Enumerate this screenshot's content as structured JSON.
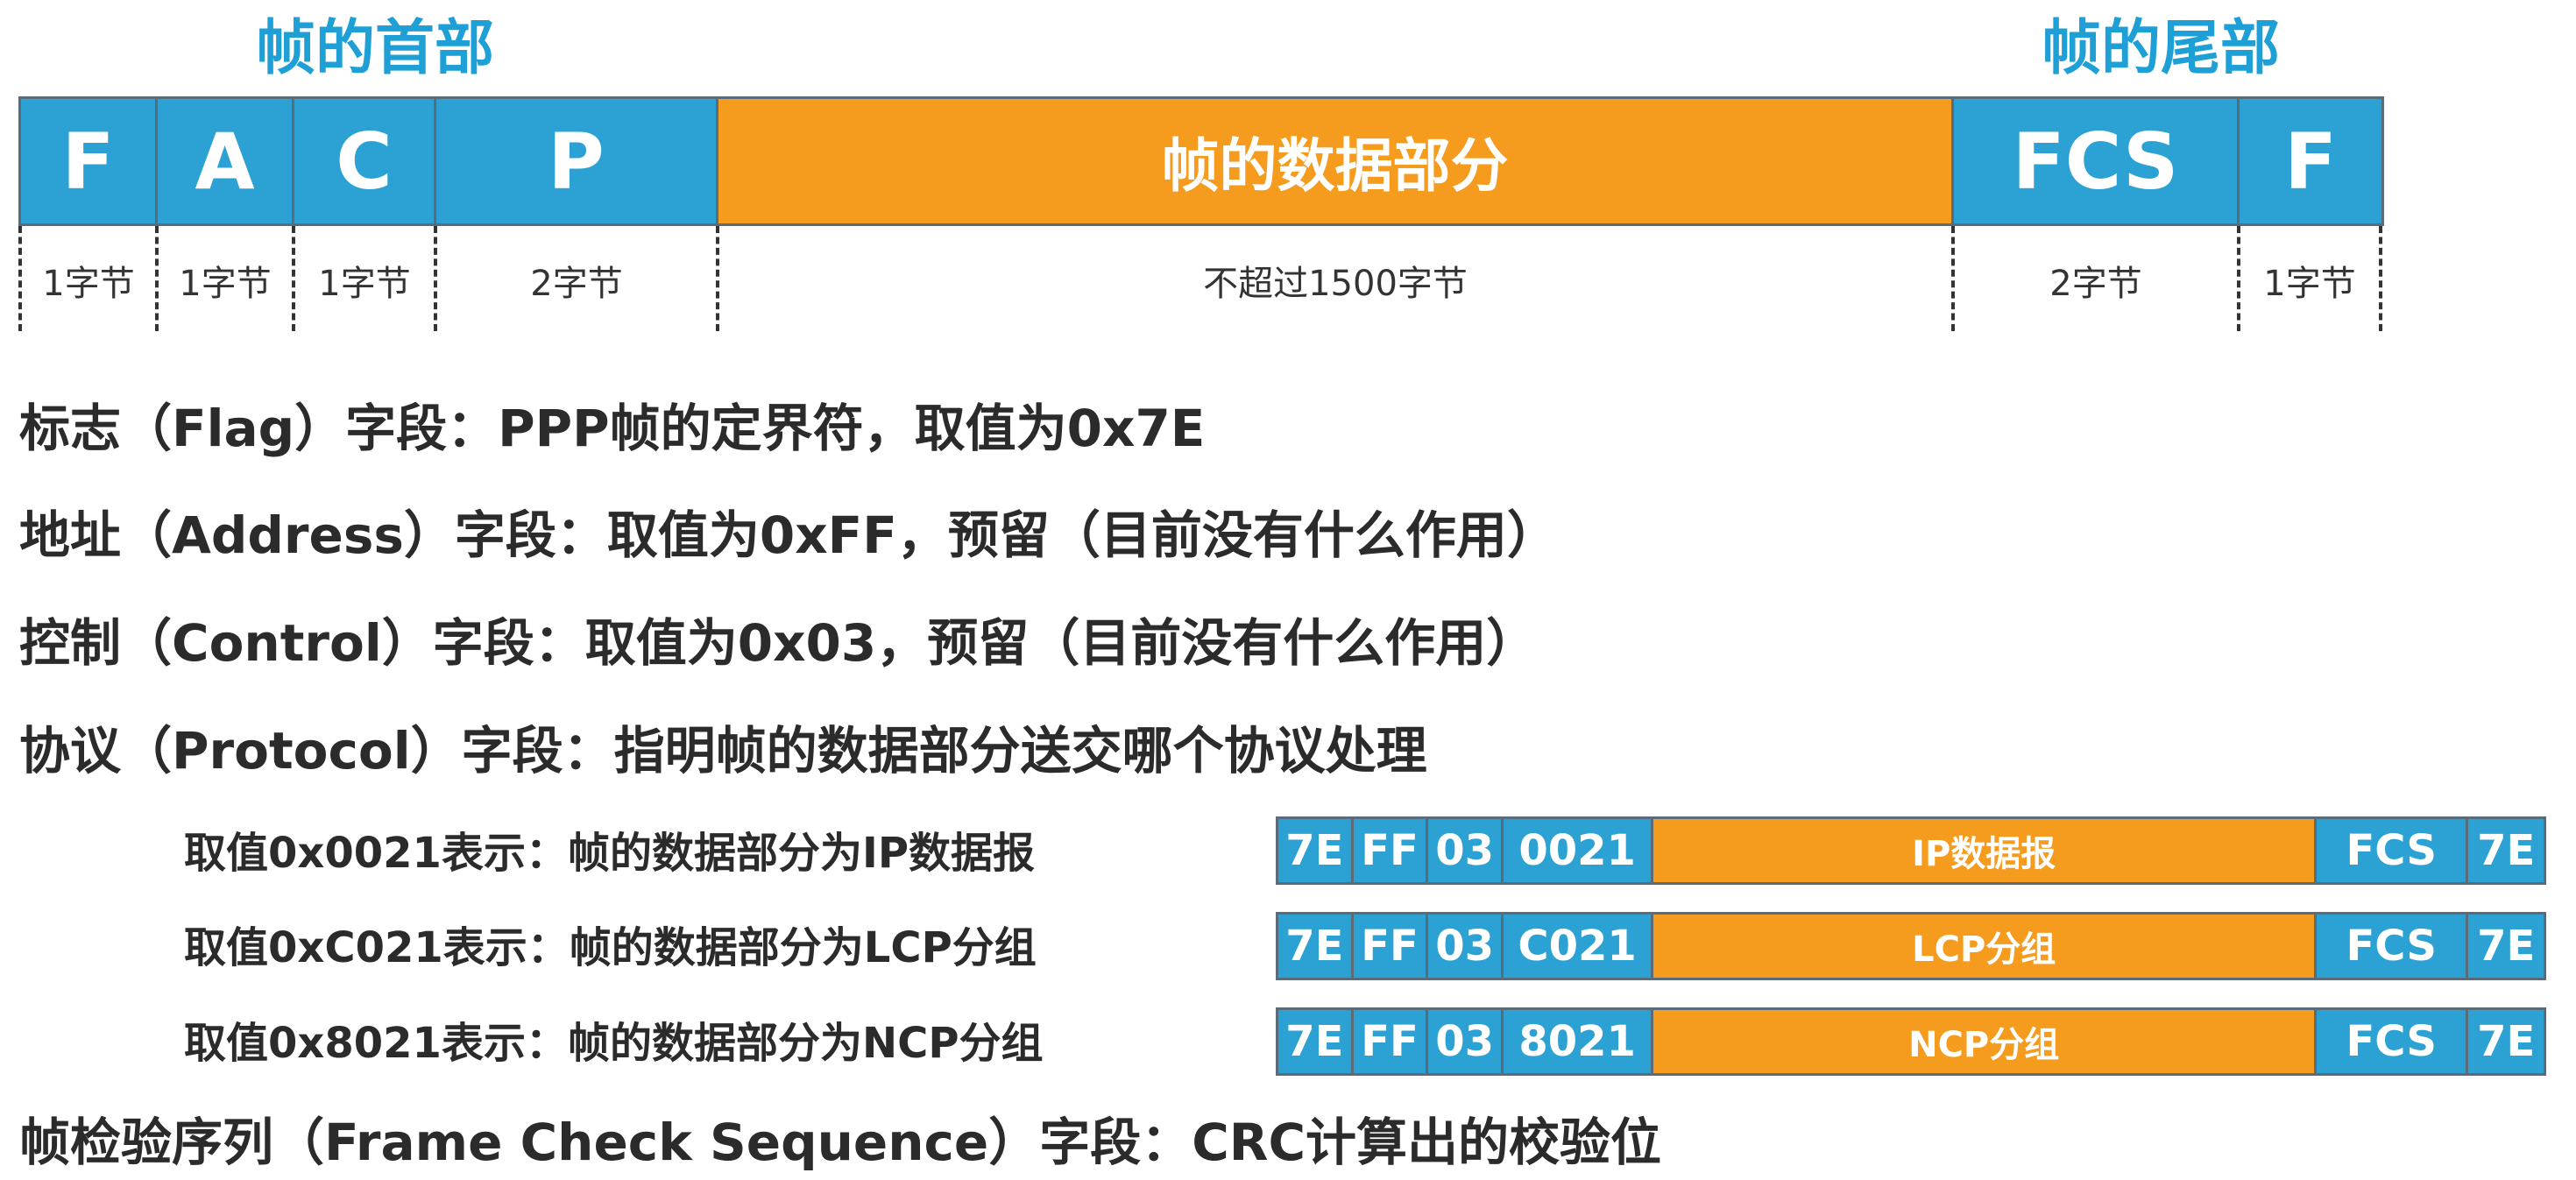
{
  "header": {
    "frame_head_label": "帧的首部",
    "frame_tail_label": "帧的尾部"
  },
  "frame": {
    "fields": [
      {
        "label": "F",
        "size": "1字节"
      },
      {
        "label": "A",
        "size": "1字节"
      },
      {
        "label": "C",
        "size": "1字节"
      },
      {
        "label": "P",
        "size": "2字节"
      },
      {
        "label": "帧的数据部分",
        "size": "不超过1500字节"
      },
      {
        "label": "FCS",
        "size": "2字节"
      },
      {
        "label": "F",
        "size": "1字节"
      }
    ]
  },
  "descriptions": {
    "flag": "标志（Flag）字段：PPP帧的定界符，取值为0x7E",
    "address": "地址（Address）字段：取值为0xFF，预留（目前没有什么作用）",
    "control": "控制（Control）字段：取值为0x03，预留（目前没有什么作用）",
    "protocol": "协议（Protocol）字段：指明帧的数据部分送交哪个协议处理",
    "fcs": "帧检验序列（Frame Check Sequence）字段：CRC计算出的校验位"
  },
  "examples": [
    {
      "text": "取值0x0021表示：帧的数据部分为IP数据报",
      "cells": [
        "7E",
        "FF",
        "03",
        "0021",
        "IP数据报",
        "FCS",
        "7E"
      ]
    },
    {
      "text": "取值0xC021表示：帧的数据部分为LCP分组",
      "cells": [
        "7E",
        "FF",
        "03",
        "C021",
        "LCP分组",
        "FCS",
        "7E"
      ]
    },
    {
      "text": "取值0x8021表示：帧的数据部分为NCP分组",
      "cells": [
        "7E",
        "FF",
        "03",
        "8021",
        "NCP分组",
        "FCS",
        "7E"
      ]
    }
  ],
  "colors": {
    "header_blue": "#1e9fd6",
    "cell_blue": "#2ca1d3",
    "cell_orange": "#f59b1d"
  }
}
